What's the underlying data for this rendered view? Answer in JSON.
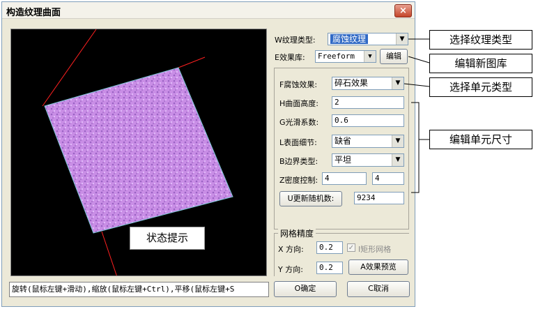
{
  "dialog": {
    "title": "构造纹理曲面",
    "close_glyph": "×"
  },
  "texture_type": {
    "label": "W纹理类型:",
    "value": "腐蚀纹理"
  },
  "effect_library": {
    "label": "E效果库:",
    "value": "Freeform",
    "edit_button": "编辑"
  },
  "corrosion": {
    "effect_label": "F腐蚀效果:",
    "effect_value": "碎石效果",
    "height_label": "H曲面高度:",
    "height_value": "2",
    "smooth_label": "G光滑系数:",
    "smooth_value": "0.6",
    "detail_label": "L表面细节:",
    "detail_value": "缺省",
    "boundary_label": "B边界类型:",
    "boundary_value": "平坦",
    "density_label": "Z密度控制:",
    "density_x": "4",
    "density_y": "4",
    "random_button": "U更新随机数:",
    "random_value": "9234"
  },
  "mesh": {
    "group_label": "网格精度",
    "x_label": "X 方向:",
    "x_value": "0.2",
    "rect_checkbox_label": "I矩形网格",
    "y_label": "Y 方向:",
    "y_value": "0.2",
    "preview_button": "A效果预览"
  },
  "status_hint": "状态提示",
  "status_bar": "旋转(鼠标左键+滑动),缩放(鼠标左键+Ctrl),平移(鼠标左键+S",
  "ok_button": "O确定",
  "cancel_button": "C取消",
  "callouts": {
    "texture_type": "选择纹理类型",
    "library": "编辑新图库",
    "cell_type": "选择单元类型",
    "cell_size": "编辑单元尺寸"
  },
  "colors": {
    "surface": "#c98ee6",
    "accent": "#316ac5",
    "axis": "#ff2020"
  }
}
